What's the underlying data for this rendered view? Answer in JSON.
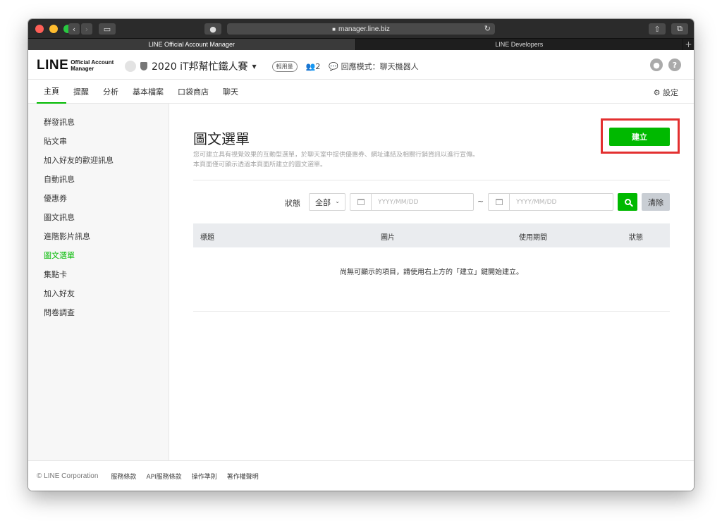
{
  "browser": {
    "url": "manager.line.biz",
    "tabs": [
      "LINE Official Account Manager",
      "LINE Developers"
    ]
  },
  "header": {
    "logo_main": "LINE",
    "logo_sub_1": "Official Account",
    "logo_sub_2": "Manager",
    "account_name": "2020 iT邦幫忙鐵人賽",
    "plan_badge": "輕用量",
    "friends_count": "2",
    "reply_mode": "回應模式：聊天機器人"
  },
  "nav": {
    "items": [
      "主頁",
      "提醒",
      "分析",
      "基本檔案",
      "口袋商店",
      "聊天"
    ],
    "active_index": 0,
    "settings_label": "設定"
  },
  "sidebar": {
    "items": [
      "群發訊息",
      "貼文串",
      "加入好友的歡迎訊息",
      "自動訊息",
      "優惠券",
      "圖文訊息",
      "進階影片訊息",
      "圖文選單",
      "集點卡",
      "加入好友",
      "問卷調查"
    ],
    "active_index": 7
  },
  "main": {
    "title": "圖文選單",
    "desc_1": "您可建立具有視覺效果的互動型選單，於聊天室中提供優惠券、網址連結及相關行銷資訊以進行宣傳。",
    "desc_2": "本頁面僅可顯示透過本頁面所建立的圖文選單。",
    "create_label": "建立",
    "filter_label": "狀態",
    "status_value": "全部",
    "date_from_placeholder": "YYYY/MM/DD",
    "date_to_placeholder": "YYYY/MM/DD",
    "tilde": "~",
    "clear_label": "清除",
    "columns": [
      "標題",
      "圖片",
      "使用期間",
      "狀態"
    ],
    "empty_message": "尚無可顯示的項目，請使用右上方的「建立」鍵開始建立。"
  },
  "footer": {
    "copyright": "© LINE Corporation",
    "links": [
      "服務條款",
      "API服務條款",
      "操作準則",
      "著作權聲明"
    ]
  },
  "colors": {
    "accent": "#00b900",
    "highlight_frame": "#e33030"
  }
}
